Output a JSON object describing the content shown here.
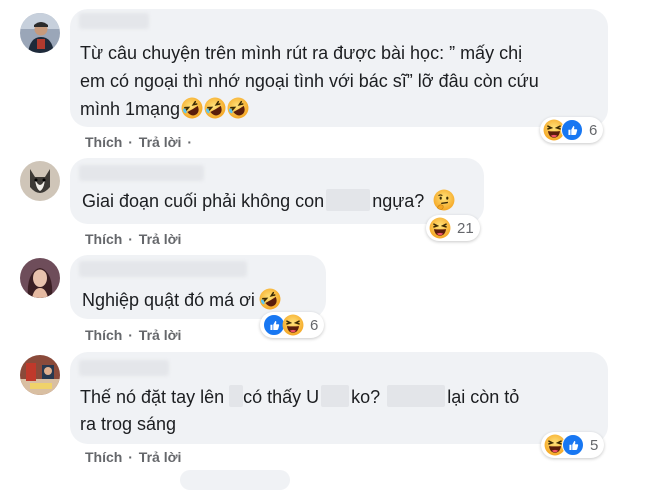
{
  "comments": [
    {
      "text_lines": [
        "Từ câu chuyện trên mình rút ra được bài học: ” mấy chị",
        "em có ngoại thì nhớ ngoại tình với bác sĩ” lỡ đâu còn cứu",
        "mình 1mạng"
      ],
      "inline_emoji": "rofl-emoji",
      "reactions": [
        "haha",
        "like"
      ],
      "reaction_count": "6"
    },
    {
      "text_a": "Giai đoạn cuối phải không con",
      "text_b": "ngựa?",
      "inline_emoji": "thinking-emoji",
      "reactions": [
        "haha"
      ],
      "reaction_count": "21"
    },
    {
      "text": "Nghiệp quật đó má ơi",
      "inline_emoji": "rofl-emoji",
      "reactions": [
        "like",
        "haha"
      ],
      "reaction_count": "6"
    },
    {
      "line1_a": "Thế nó đặt tay lên",
      "line1_b": "có thấy U",
      "line1_c": "ko?",
      "line1_d": "lại còn tỏ",
      "line2": "ra trog sáng",
      "reactions": [
        "haha",
        "like"
      ],
      "reaction_count": "5"
    }
  ],
  "actions": {
    "like": "Thích",
    "reply": "Trả lời",
    "separator": "·"
  },
  "colors": {
    "like_blue": "#1877f2",
    "haha_yellow": "#f7b125",
    "bubble": "#f0f2f5",
    "meta_gray": "#65676b"
  }
}
